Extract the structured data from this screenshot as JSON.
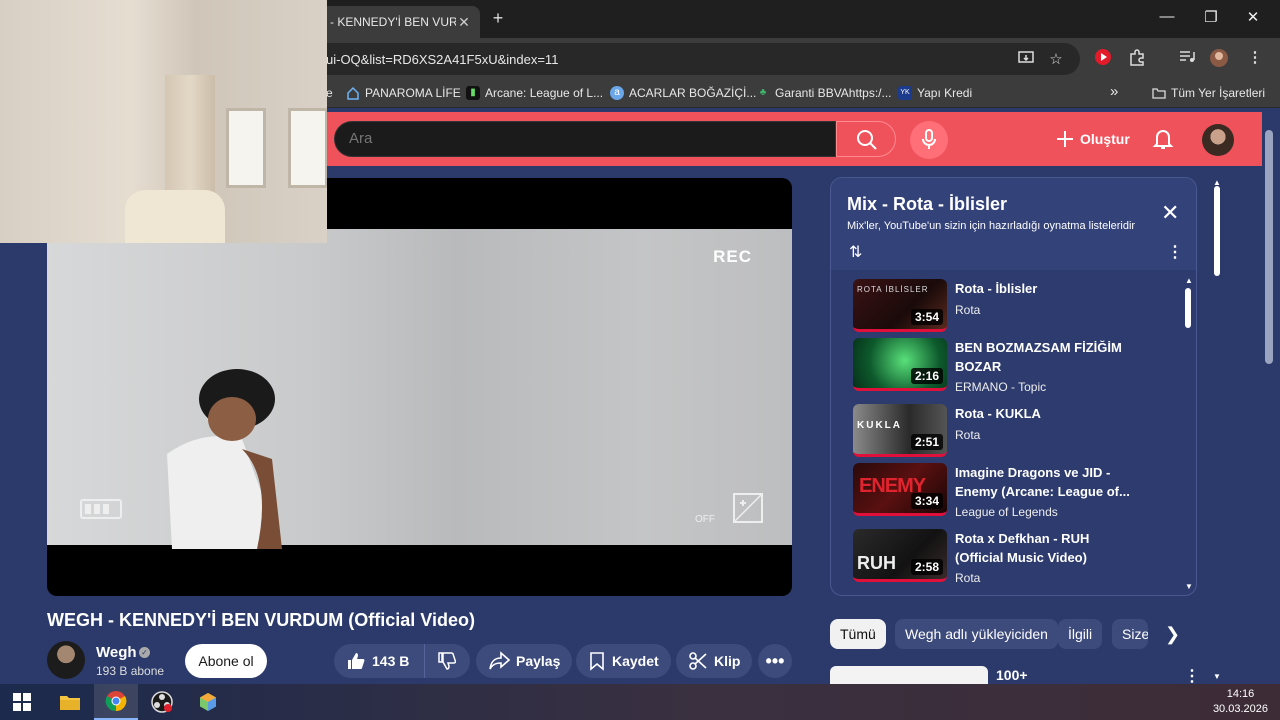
{
  "browser": {
    "tab_title": "- KENNEDY'İ BEN VURDUM",
    "tab_close": "✕",
    "new_tab": "+",
    "url": "ui-OQ&list=RD6XS2A41F5xU&index=11",
    "window_controls": {
      "minimize": "—",
      "maximize": "❐",
      "close": "✕"
    },
    "bookmarks": [
      {
        "label": "PANAROMA LİFE",
        "icon": "home-icon"
      },
      {
        "label": "Arcane: League of L...",
        "icon": "site-icon"
      },
      {
        "label": "ACARLAR BOĞAZİÇİ...",
        "icon": "globe-icon"
      },
      {
        "label": "Garanti BBVAhttps:/...",
        "icon": "bank-icon"
      },
      {
        "label": "Yapı Kredi",
        "icon": "bank-icon"
      }
    ],
    "bookmarks_overflow": "»",
    "all_bookmarks": "Tüm Yer İşaretleri"
  },
  "youtube": {
    "search_placeholder": "Ara",
    "create_label": "Oluştur",
    "brand_color": "#f0525c"
  },
  "player": {
    "overlay_rec": "REC",
    "overlay_off": "OFF"
  },
  "video": {
    "title": "WEGH - KENNEDY'İ BEN VURDUM (Official Video)",
    "channel": "Wegh",
    "subscribers": "193 B abone",
    "subscribe_label": "Abone ol",
    "likes": "143 B",
    "share_label": "Paylaş",
    "save_label": "Kaydet",
    "clip_label": "Klip"
  },
  "playlist": {
    "title": "Mix - Rota - İblisler",
    "subtitle": "Mix'ler, YouTube'un sizin için hazırladığı oynatma listeleridir",
    "items": [
      {
        "title": "Rota - İblisler",
        "channel": "Rota",
        "duration": "3:54",
        "thumb_label": "ROTA İBLİSLER"
      },
      {
        "title": "BEN BOZMAZSAM FİZİĞİM BOZAR",
        "channel": "ERMANO - Topic",
        "duration": "2:16",
        "thumb_label": ""
      },
      {
        "title": "Rota - KUKLA",
        "channel": "Rota",
        "duration": "2:51",
        "thumb_label": "KUKLA"
      },
      {
        "title": "Imagine Dragons ve JID - Enemy (Arcane: League of...",
        "channel": "League of Legends",
        "duration": "3:34",
        "thumb_label": "ENEMY"
      },
      {
        "title": "Rota x Defkhan - RUH (Official Music Video)",
        "channel": "Rota",
        "duration": "2:58",
        "thumb_label": "RUH"
      }
    ]
  },
  "chips": [
    "Tümü",
    "Wegh adlı yükleyiciden",
    "İlgili",
    "Size"
  ],
  "next_recommendation": {
    "title": "100+"
  },
  "taskbar": {
    "time": "14:16",
    "date": "30.03.2026"
  }
}
